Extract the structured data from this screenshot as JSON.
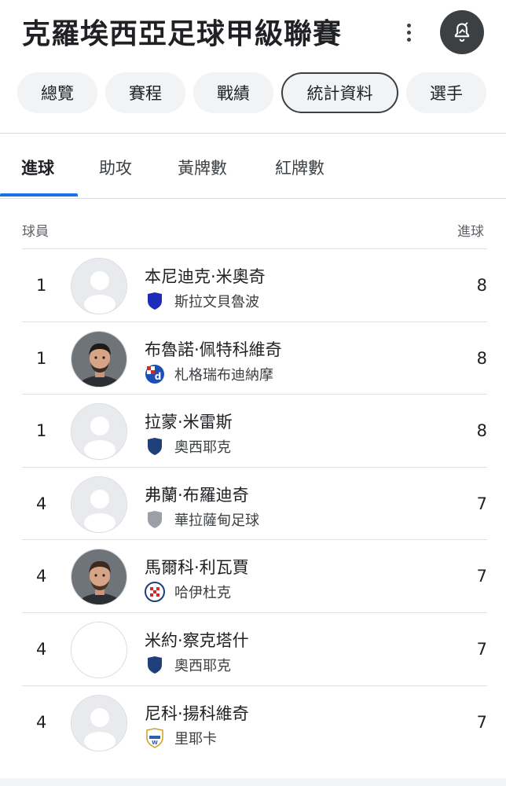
{
  "header": {
    "title": "克羅埃西亞足球甲級聯賽",
    "more_icon": "more-vert-icon",
    "alert_icon": "notification-bell-icon"
  },
  "tabs": [
    {
      "label": "總覽",
      "active": false
    },
    {
      "label": "賽程",
      "active": false
    },
    {
      "label": "戰績",
      "active": false
    },
    {
      "label": "統計資料",
      "active": true
    },
    {
      "label": "選手",
      "active": false
    }
  ],
  "subtabs": [
    {
      "label": "進球",
      "active": true
    },
    {
      "label": "助攻",
      "active": false
    },
    {
      "label": "黃牌數",
      "active": false
    },
    {
      "label": "紅牌數",
      "active": false
    }
  ],
  "table": {
    "col_player": "球員",
    "col_goals": "進球",
    "rows": [
      {
        "rank": "1",
        "name": "本尼迪克·米奧奇",
        "team": "斯拉文貝魯波",
        "goals": "8",
        "avatar": "placeholder",
        "badge": "shield-blue-icon"
      },
      {
        "rank": "1",
        "name": "布魯諾·佩特科維奇",
        "team": "札格瑞布迪納摩",
        "goals": "8",
        "avatar": "photo",
        "badge": "dinamo-zagreb-crest-icon"
      },
      {
        "rank": "1",
        "name": "拉蒙·米雷斯",
        "team": "奧西耶克",
        "goals": "8",
        "avatar": "placeholder",
        "badge": "shield-navy-icon"
      },
      {
        "rank": "4",
        "name": "弗蘭·布羅迪奇",
        "team": "華拉薩甸足球",
        "goals": "7",
        "avatar": "placeholder",
        "badge": "shield-grey-icon"
      },
      {
        "rank": "4",
        "name": "馬爾科·利瓦賈",
        "team": "哈伊杜克",
        "goals": "7",
        "avatar": "photo",
        "badge": "hajduk-crest-icon"
      },
      {
        "rank": "4",
        "name": "米約·察克塔什",
        "team": "奧西耶克",
        "goals": "7",
        "avatar": "blank",
        "badge": "shield-navy-icon"
      },
      {
        "rank": "4",
        "name": "尼科·揚科維奇",
        "team": "里耶卡",
        "goals": "7",
        "avatar": "placeholder",
        "badge": "rijeka-crest-icon"
      }
    ]
  },
  "colors": {
    "accent": "#1a73e8",
    "chip_bg": "#f1f3f4",
    "text": "#202124",
    "secondary_text": "#5f6368"
  }
}
